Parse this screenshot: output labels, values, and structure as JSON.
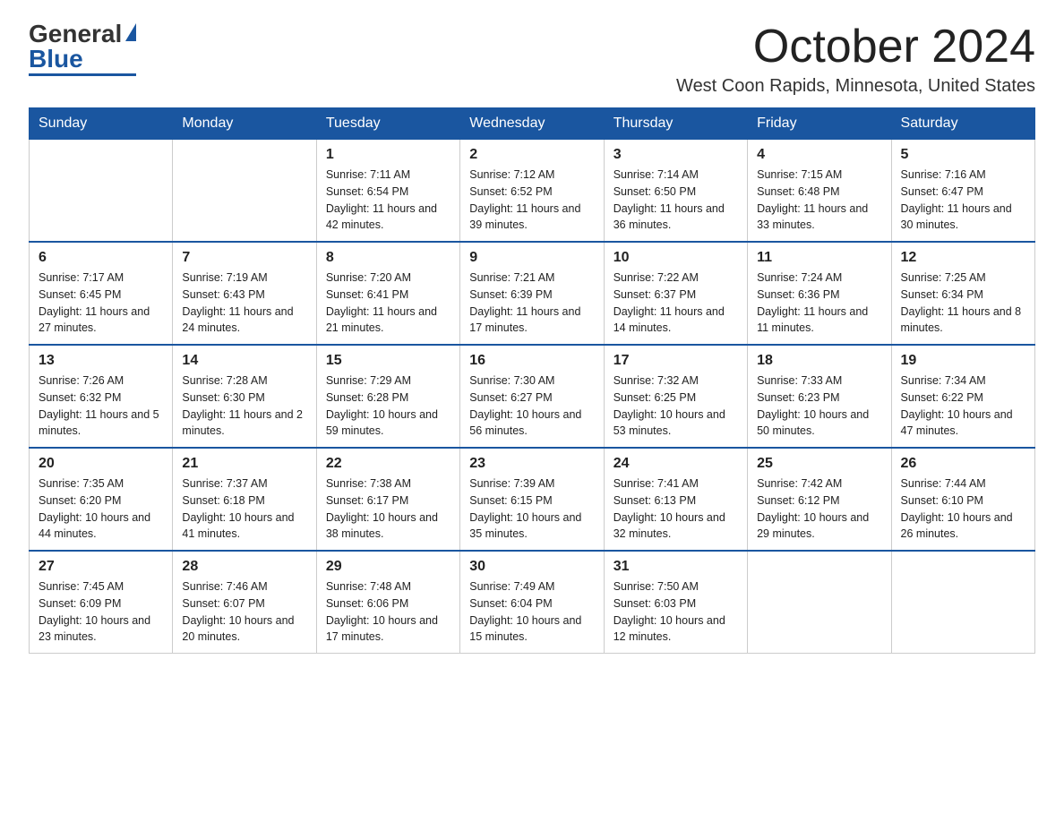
{
  "logo": {
    "general": "General",
    "blue": "Blue"
  },
  "title": "October 2024",
  "location": "West Coon Rapids, Minnesota, United States",
  "days_of_week": [
    "Sunday",
    "Monday",
    "Tuesday",
    "Wednesday",
    "Thursday",
    "Friday",
    "Saturday"
  ],
  "weeks": [
    [
      {
        "day": "",
        "sunrise": "",
        "sunset": "",
        "daylight": ""
      },
      {
        "day": "",
        "sunrise": "",
        "sunset": "",
        "daylight": ""
      },
      {
        "day": "1",
        "sunrise": "Sunrise: 7:11 AM",
        "sunset": "Sunset: 6:54 PM",
        "daylight": "Daylight: 11 hours and 42 minutes."
      },
      {
        "day": "2",
        "sunrise": "Sunrise: 7:12 AM",
        "sunset": "Sunset: 6:52 PM",
        "daylight": "Daylight: 11 hours and 39 minutes."
      },
      {
        "day": "3",
        "sunrise": "Sunrise: 7:14 AM",
        "sunset": "Sunset: 6:50 PM",
        "daylight": "Daylight: 11 hours and 36 minutes."
      },
      {
        "day": "4",
        "sunrise": "Sunrise: 7:15 AM",
        "sunset": "Sunset: 6:48 PM",
        "daylight": "Daylight: 11 hours and 33 minutes."
      },
      {
        "day": "5",
        "sunrise": "Sunrise: 7:16 AM",
        "sunset": "Sunset: 6:47 PM",
        "daylight": "Daylight: 11 hours and 30 minutes."
      }
    ],
    [
      {
        "day": "6",
        "sunrise": "Sunrise: 7:17 AM",
        "sunset": "Sunset: 6:45 PM",
        "daylight": "Daylight: 11 hours and 27 minutes."
      },
      {
        "day": "7",
        "sunrise": "Sunrise: 7:19 AM",
        "sunset": "Sunset: 6:43 PM",
        "daylight": "Daylight: 11 hours and 24 minutes."
      },
      {
        "day": "8",
        "sunrise": "Sunrise: 7:20 AM",
        "sunset": "Sunset: 6:41 PM",
        "daylight": "Daylight: 11 hours and 21 minutes."
      },
      {
        "day": "9",
        "sunrise": "Sunrise: 7:21 AM",
        "sunset": "Sunset: 6:39 PM",
        "daylight": "Daylight: 11 hours and 17 minutes."
      },
      {
        "day": "10",
        "sunrise": "Sunrise: 7:22 AM",
        "sunset": "Sunset: 6:37 PM",
        "daylight": "Daylight: 11 hours and 14 minutes."
      },
      {
        "day": "11",
        "sunrise": "Sunrise: 7:24 AM",
        "sunset": "Sunset: 6:36 PM",
        "daylight": "Daylight: 11 hours and 11 minutes."
      },
      {
        "day": "12",
        "sunrise": "Sunrise: 7:25 AM",
        "sunset": "Sunset: 6:34 PM",
        "daylight": "Daylight: 11 hours and 8 minutes."
      }
    ],
    [
      {
        "day": "13",
        "sunrise": "Sunrise: 7:26 AM",
        "sunset": "Sunset: 6:32 PM",
        "daylight": "Daylight: 11 hours and 5 minutes."
      },
      {
        "day": "14",
        "sunrise": "Sunrise: 7:28 AM",
        "sunset": "Sunset: 6:30 PM",
        "daylight": "Daylight: 11 hours and 2 minutes."
      },
      {
        "day": "15",
        "sunrise": "Sunrise: 7:29 AM",
        "sunset": "Sunset: 6:28 PM",
        "daylight": "Daylight: 10 hours and 59 minutes."
      },
      {
        "day": "16",
        "sunrise": "Sunrise: 7:30 AM",
        "sunset": "Sunset: 6:27 PM",
        "daylight": "Daylight: 10 hours and 56 minutes."
      },
      {
        "day": "17",
        "sunrise": "Sunrise: 7:32 AM",
        "sunset": "Sunset: 6:25 PM",
        "daylight": "Daylight: 10 hours and 53 minutes."
      },
      {
        "day": "18",
        "sunrise": "Sunrise: 7:33 AM",
        "sunset": "Sunset: 6:23 PM",
        "daylight": "Daylight: 10 hours and 50 minutes."
      },
      {
        "day": "19",
        "sunrise": "Sunrise: 7:34 AM",
        "sunset": "Sunset: 6:22 PM",
        "daylight": "Daylight: 10 hours and 47 minutes."
      }
    ],
    [
      {
        "day": "20",
        "sunrise": "Sunrise: 7:35 AM",
        "sunset": "Sunset: 6:20 PM",
        "daylight": "Daylight: 10 hours and 44 minutes."
      },
      {
        "day": "21",
        "sunrise": "Sunrise: 7:37 AM",
        "sunset": "Sunset: 6:18 PM",
        "daylight": "Daylight: 10 hours and 41 minutes."
      },
      {
        "day": "22",
        "sunrise": "Sunrise: 7:38 AM",
        "sunset": "Sunset: 6:17 PM",
        "daylight": "Daylight: 10 hours and 38 minutes."
      },
      {
        "day": "23",
        "sunrise": "Sunrise: 7:39 AM",
        "sunset": "Sunset: 6:15 PM",
        "daylight": "Daylight: 10 hours and 35 minutes."
      },
      {
        "day": "24",
        "sunrise": "Sunrise: 7:41 AM",
        "sunset": "Sunset: 6:13 PM",
        "daylight": "Daylight: 10 hours and 32 minutes."
      },
      {
        "day": "25",
        "sunrise": "Sunrise: 7:42 AM",
        "sunset": "Sunset: 6:12 PM",
        "daylight": "Daylight: 10 hours and 29 minutes."
      },
      {
        "day": "26",
        "sunrise": "Sunrise: 7:44 AM",
        "sunset": "Sunset: 6:10 PM",
        "daylight": "Daylight: 10 hours and 26 minutes."
      }
    ],
    [
      {
        "day": "27",
        "sunrise": "Sunrise: 7:45 AM",
        "sunset": "Sunset: 6:09 PM",
        "daylight": "Daylight: 10 hours and 23 minutes."
      },
      {
        "day": "28",
        "sunrise": "Sunrise: 7:46 AM",
        "sunset": "Sunset: 6:07 PM",
        "daylight": "Daylight: 10 hours and 20 minutes."
      },
      {
        "day": "29",
        "sunrise": "Sunrise: 7:48 AM",
        "sunset": "Sunset: 6:06 PM",
        "daylight": "Daylight: 10 hours and 17 minutes."
      },
      {
        "day": "30",
        "sunrise": "Sunrise: 7:49 AM",
        "sunset": "Sunset: 6:04 PM",
        "daylight": "Daylight: 10 hours and 15 minutes."
      },
      {
        "day": "31",
        "sunrise": "Sunrise: 7:50 AM",
        "sunset": "Sunset: 6:03 PM",
        "daylight": "Daylight: 10 hours and 12 minutes."
      },
      {
        "day": "",
        "sunrise": "",
        "sunset": "",
        "daylight": ""
      },
      {
        "day": "",
        "sunrise": "",
        "sunset": "",
        "daylight": ""
      }
    ]
  ]
}
